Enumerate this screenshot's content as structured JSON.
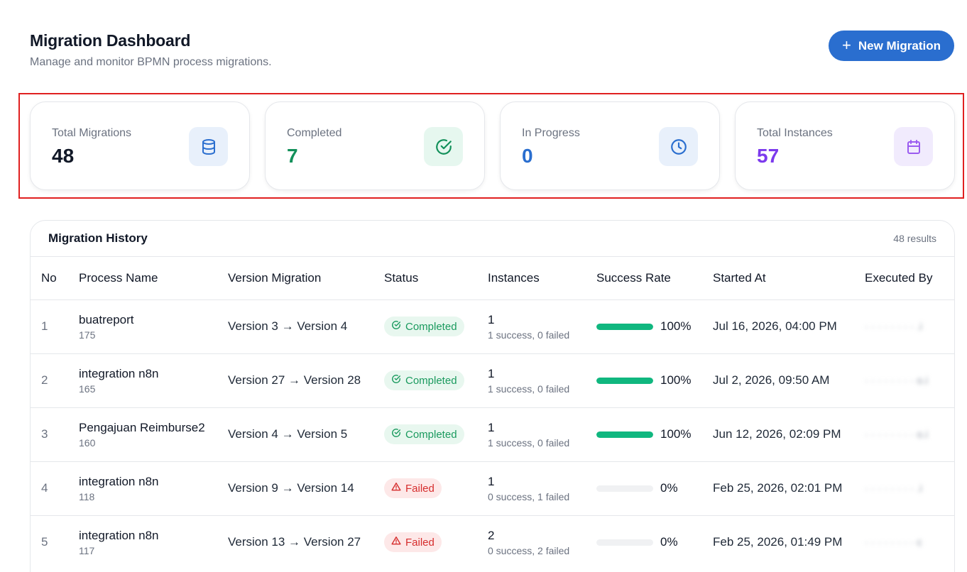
{
  "header": {
    "title": "Migration Dashboard",
    "subtitle": "Manage and monitor BPMN process migrations.",
    "new_button_label": "New Migration"
  },
  "stats": [
    {
      "label": "Total Migrations",
      "value": "48",
      "color": "#111827",
      "icon": "database-icon",
      "icon_bg": "#e8f0fb",
      "icon_color": "#2a6ecf"
    },
    {
      "label": "Completed",
      "value": "7",
      "color": "#12905a",
      "icon": "check-circle-icon",
      "icon_bg": "#e6f7ef",
      "icon_color": "#12905a"
    },
    {
      "label": "In Progress",
      "value": "0",
      "color": "#2a6ecf",
      "icon": "clock-icon",
      "icon_bg": "#e8f0fb",
      "icon_color": "#2a6ecf"
    },
    {
      "label": "Total Instances",
      "value": "57",
      "color": "#7c3aed",
      "icon": "calendar-icon",
      "icon_bg": "#f1ebfd",
      "icon_color": "#9b5cf0"
    }
  ],
  "history": {
    "title": "Migration History",
    "count": "48 results",
    "columns": [
      "No",
      "Process Name",
      "Version Migration",
      "Status",
      "Instances",
      "Success Rate",
      "Started At",
      "Executed By"
    ],
    "rows": [
      {
        "no": "1",
        "name": "buatreport",
        "id": "175",
        "version": "Version 3 → Version 4",
        "status": "Completed",
        "status_type": "ok",
        "instances": "1",
        "instances_detail": "1 success, 0 failed",
        "rate": 100,
        "rate_label": "100%",
        "started": "Jul 16, 2026, 04:00 PM",
        "executed": "·  ·  ·  ·  ·  ·  ·  ·  .i"
      },
      {
        "no": "2",
        "name": "integration n8n",
        "id": "165",
        "version": "Version 27 → Version 28",
        "status": "Completed",
        "status_type": "ok",
        "instances": "1",
        "instances_detail": "1 success, 0 failed",
        "rate": 100,
        "rate_label": "100%",
        "started": "Jul 2, 2026, 09:50 AM",
        "executed": "·  ·  ·  ·  ·  ·  ·  ·  o.i"
      },
      {
        "no": "3",
        "name": "Pengajuan Reimburse2",
        "id": "160",
        "version": "Version 4 → Version 5",
        "status": "Completed",
        "status_type": "ok",
        "instances": "1",
        "instances_detail": "1 success, 0 failed",
        "rate": 100,
        "rate_label": "100%",
        "started": "Jun 12, 2026, 02:09 PM",
        "executed": "·  ·  ·  ·  ·  ·  ·  ·  o.i"
      },
      {
        "no": "4",
        "name": "integration n8n",
        "id": "118",
        "version": "Version 9 → Version 14",
        "status": "Failed",
        "status_type": "fail",
        "instances": "1",
        "instances_detail": "0 success, 1 failed",
        "rate": 0,
        "rate_label": "0%",
        "started": "Feb 25, 2026, 02:01 PM",
        "executed": "·  ·  ·  ·  ·  ·  ·  ·  .i"
      },
      {
        "no": "5",
        "name": "integration n8n",
        "id": "117",
        "version": "Version 13 → Version 27",
        "status": "Failed",
        "status_type": "fail",
        "instances": "2",
        "instances_detail": "0 success, 2 failed",
        "rate": 0,
        "rate_label": "0%",
        "started": "Feb 25, 2026, 01:49 PM",
        "executed": "·  ·  ·  ·  ·  ·  ·  ·  c"
      }
    ]
  }
}
